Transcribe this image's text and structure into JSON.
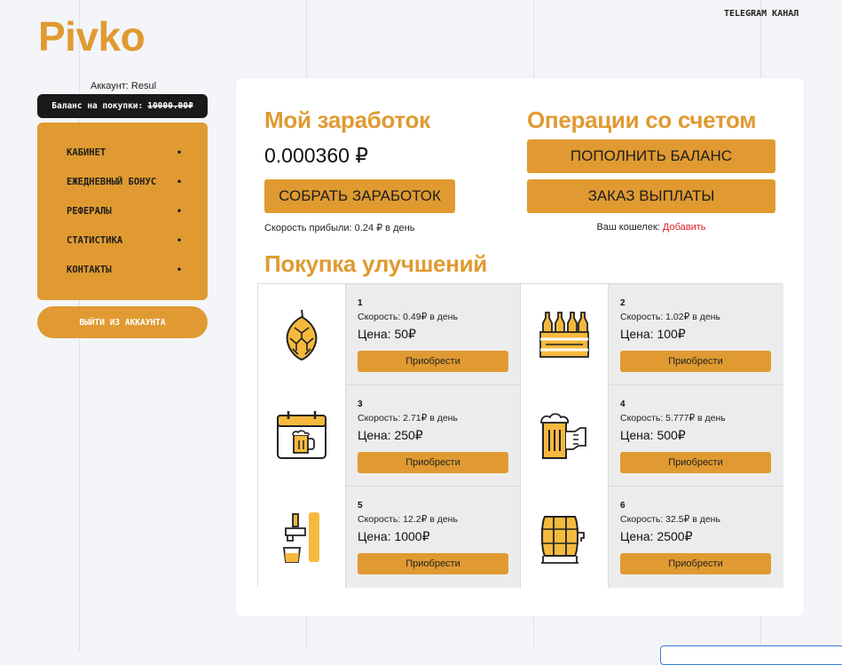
{
  "brand": {
    "logo": "Pivko",
    "telegram_link": "TELEGRAM КАНАЛ",
    "accent_color": "#e09a31"
  },
  "sidebar": {
    "account_label": "Аккаунт: Resul",
    "balance_label": "Баланс на покупки:",
    "balance_amount": "10000.00₽",
    "menu": [
      {
        "label": "КАБИНЕТ"
      },
      {
        "label": "ЕЖЕДНЕВНЫЙ БОНУС"
      },
      {
        "label": "РЕФЕРАЛЫ"
      },
      {
        "label": "СТАТИСТИКА"
      },
      {
        "label": "КОНТАКТЫ"
      }
    ],
    "logout_label": "ВЫЙТИ ИЗ АККАУНТА"
  },
  "earnings": {
    "title": "Мой заработок",
    "value": "0.000360 ₽",
    "collect_label": "СОБРАТЬ ЗАРАБОТОК",
    "speed_text": "Скорость прибыли: 0.24 ₽ в день"
  },
  "operations": {
    "title": "Операции со счетом",
    "topup_label": "ПОПОЛНИТЬ БАЛАНС",
    "withdraw_label": "ЗАКАЗ ВЫПЛАТЫ",
    "wallet_text": "Ваш кошелек:",
    "wallet_link": "Добавить"
  },
  "upgrades": {
    "title": "Покупка улучшений",
    "items": [
      {
        "num": "1",
        "speed": "Скорость: 0.49₽ в день",
        "price": "Цена: 50₽",
        "button": "Приобрести",
        "icon": "hop-icon"
      },
      {
        "num": "2",
        "speed": "Скорость: 1.02₽ в день",
        "price": "Цена: 100₽",
        "button": "Приобрести",
        "icon": "beer-crate-icon"
      },
      {
        "num": "3",
        "speed": "Скорость: 2.71₽ в день",
        "price": "Цена: 250₽",
        "button": "Приобрести",
        "icon": "beer-calendar-icon"
      },
      {
        "num": "4",
        "speed": "Скорость: 5.777₽ в день",
        "price": "Цена: 500₽",
        "button": "Приобрести",
        "icon": "beer-mug-hand-icon"
      },
      {
        "num": "5",
        "speed": "Скорость: 12.2₽ в день",
        "price": "Цена: 1000₽",
        "button": "Приобрести",
        "icon": "beer-tap-icon"
      },
      {
        "num": "6",
        "speed": "Скорость: 32.5₽ в день",
        "price": "Цена: 2500₽",
        "button": "Приобрести",
        "icon": "beer-barrel-icon"
      }
    ]
  }
}
